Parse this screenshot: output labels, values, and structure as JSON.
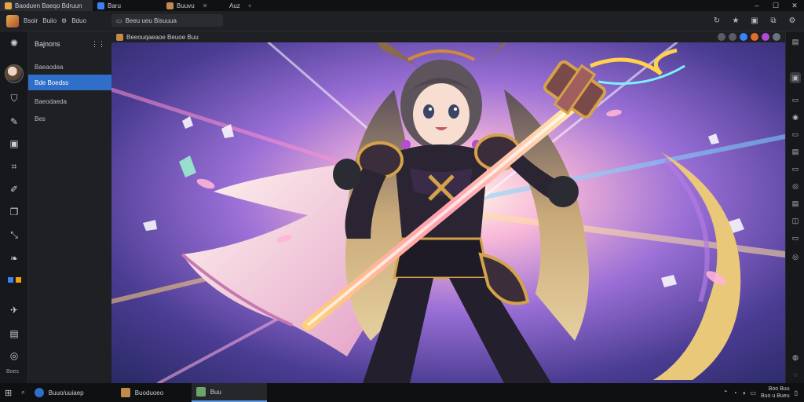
{
  "titlebar": {
    "tabs": [
      {
        "label": "Baoduen Baeqo Bdruun",
        "icon": "app-logo-icon",
        "color": "#e0a94a"
      },
      {
        "label": "Baru",
        "icon": "window-icon",
        "color": "#3b82f6"
      },
      {
        "label": "Buuvu",
        "icon": "image-tab-icon",
        "color": "#c48a4b"
      },
      {
        "label": "Auz",
        "icon": "blank-tab-icon",
        "color": "#2a2c31"
      }
    ],
    "new_tab": "+",
    "window_controls": [
      "–",
      "☐",
      "✕"
    ]
  },
  "toolbar": {
    "menu": [
      "Bsoir",
      "Buiio",
      "Bduo"
    ],
    "address": "Beeu ueu Bisuuua",
    "icons": [
      "refresh-icon",
      "star-icon",
      "collections-icon",
      "extensions-icon",
      "settings-icon"
    ]
  },
  "sidebar": {
    "header": "Bajnons",
    "items": [
      {
        "label": "Baeaodea"
      },
      {
        "label": "Bde Boedss",
        "active": true
      },
      {
        "label": "Baeodaeda"
      },
      {
        "label": "Bes"
      }
    ],
    "rail_label": "Boes"
  },
  "content": {
    "title": "Beeouqaeaoe Beuoe Buu",
    "header_icon_colors": [
      "#5a5d63",
      "#5a5d63",
      "#3b82f6",
      "#e06c2e",
      "#b04ad8",
      "#6b7280"
    ]
  },
  "taskbar": {
    "search_text": "Buuo/uuiaep",
    "apps": [
      {
        "label": "Buoduoeo",
        "color": "#c48a4b",
        "active": false
      },
      {
        "label": "Buu",
        "color": "#6ea36e",
        "active": true
      }
    ],
    "clock_time": "Boo Buu",
    "clock_date": "Buo u Bueu"
  },
  "colors": {
    "accent": "#2f6ec9",
    "chrome_dark": "#101113",
    "panel": "#1e2024"
  }
}
